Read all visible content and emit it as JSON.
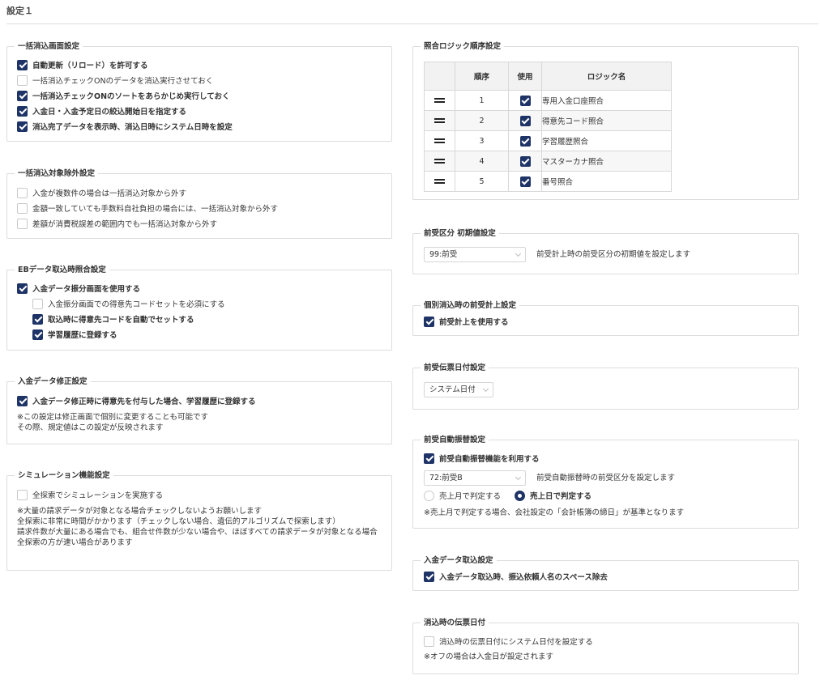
{
  "page": {
    "title": "設定１"
  },
  "bulk_clear": {
    "title": "一括消込画面設定",
    "items": [
      {
        "label": "自動更新（リロード）を許可する",
        "checked": true
      },
      {
        "label": "一括消込チェックONのデータを消込実行させておく",
        "checked": false
      },
      {
        "label": "一括消込チェックONのソートをあらかじめ実行しておく",
        "checked": true
      },
      {
        "label": "入金日・入金予定日の絞込開始日を指定する",
        "checked": true
      },
      {
        "label": "消込完了データを表示時、消込日時にシステム日時を設定",
        "checked": true
      }
    ]
  },
  "exclusion": {
    "title": "一括消込対象除外設定",
    "items": [
      {
        "label": "入金が複数件の場合は一括消込対象から外す",
        "checked": false
      },
      {
        "label": "金額一致していても手数料自社負担の場合には、一括消込対象から外す",
        "checked": false
      },
      {
        "label": "差額が消費税誤差の範囲内でも一括消込対象から外す",
        "checked": false
      }
    ]
  },
  "eb_import": {
    "title": "EBデータ取込時照合設定",
    "items": [
      {
        "label": "入金データ振分画面を使用する",
        "checked": true
      },
      {
        "label": "入金振分画面での得意先コードセットを必須にする",
        "checked": false
      },
      {
        "label": "取込時に得意先コードを自動でセットする",
        "checked": true
      },
      {
        "label": "学習履歴に登録する",
        "checked": true
      }
    ]
  },
  "payment_fix": {
    "title": "入金データ修正設定",
    "item": {
      "label": "入金データ修正時に得意先を付与した場合、学習履歴に登録する",
      "checked": true
    },
    "note1": "※この設定は修正画面で個別に変更することも可能です",
    "note2": "その際、規定値はこの設定が反映されます"
  },
  "simulation": {
    "title": "シミュレーション機能設定",
    "item": {
      "label": "全探索でシミュレーションを実施する",
      "checked": false
    },
    "notes": [
      "※大量の請求データが対象となる場合チェックしないようお願いします",
      "全探索に非常に時間がかかります（チェックしない場合、遺伝的アルゴリズムで探索します）",
      "請求件数が大量にある場合でも、組合せ件数が少ない場合や、ほぼすべての請求データが対象となる場合",
      "全探索の方が速い場合があります"
    ]
  },
  "logic_order": {
    "title": "照合ロジック順序設定",
    "headers": {
      "order": "順序",
      "use": "使用",
      "name": "ロジック名"
    },
    "rows": [
      {
        "order": "1",
        "use": true,
        "name": "専用入金口座照合"
      },
      {
        "order": "2",
        "use": true,
        "name": "得意先コード照合"
      },
      {
        "order": "3",
        "use": true,
        "name": "学習履歴照合"
      },
      {
        "order": "4",
        "use": true,
        "name": "マスターカナ照合"
      },
      {
        "order": "5",
        "use": true,
        "name": "番号照合"
      }
    ]
  },
  "advance_default": {
    "title": "前受区分 初期値設定",
    "select_value": "99:前受",
    "description": "前受計上時の前受区分の初期値を設定します"
  },
  "individual_advance": {
    "title": "個別消込時の前受計上設定",
    "item": {
      "label": "前受計上を使用する",
      "checked": true
    }
  },
  "advance_date": {
    "title": "前受伝票日付設定",
    "select_value": "システム日付"
  },
  "advance_transfer": {
    "title": "前受自動振替設定",
    "item": {
      "label": "前受自動振替機能を利用する",
      "checked": true
    },
    "select_value": "72:前受B",
    "description": "前受自動振替時の前受区分を設定します",
    "radio1": {
      "label": "売上月で判定する",
      "selected": false
    },
    "radio2": {
      "label": "売上日で判定する",
      "selected": true
    },
    "note": "※売上月で判定する場合、会社設定の「会計帳簿の締日」が基準となります"
  },
  "payment_import": {
    "title": "入金データ取込設定",
    "item": {
      "label": "入金データ取込時、振込依頼人名のスペース除去",
      "checked": true
    }
  },
  "clear_date": {
    "title": "消込時の伝票日付",
    "item": {
      "label": "消込時の伝票日付にシステム日付を設定する",
      "checked": false
    },
    "note": "※オフの場合は入金日が設定されます"
  },
  "colors": {
    "accent": "#1e3366",
    "border": "#dcdcdc"
  }
}
